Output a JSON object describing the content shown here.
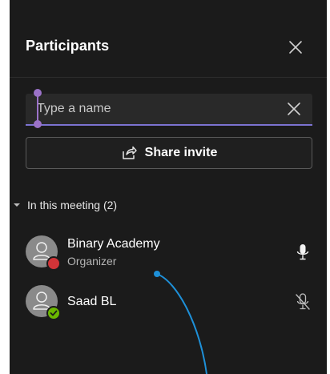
{
  "panel": {
    "title": "Participants",
    "close_icon": "close-icon"
  },
  "search": {
    "placeholder": "Type a name",
    "value": "",
    "clear_icon": "close-icon"
  },
  "share": {
    "label": "Share invite",
    "icon": "share-icon"
  },
  "section": {
    "label": "In this meeting (2)",
    "icon": "caret-down-icon"
  },
  "participants": [
    {
      "name": "Binary Academy",
      "role": "Organizer",
      "status_color": "#d13438",
      "mic": "mic-on-icon"
    },
    {
      "name": "Saad BL",
      "role": "",
      "status_color": "#6bb700",
      "mic": "mic-off-icon"
    }
  ],
  "colors": {
    "background": "#1b1b1b",
    "accent": "#7c73d1",
    "annotation": "#1e90d8"
  }
}
